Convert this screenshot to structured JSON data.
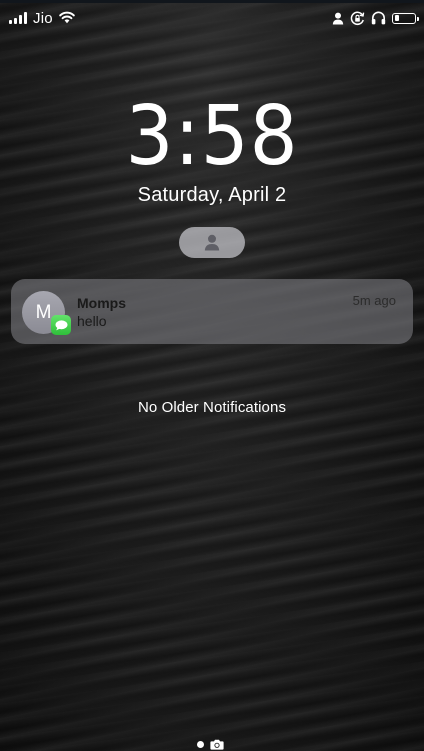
{
  "status_bar": {
    "carrier": "Jio",
    "battery_level": 0.25,
    "icons": [
      "signal-icon",
      "wifi-icon",
      "person-icon",
      "orientation-lock-icon",
      "headphones-icon",
      "battery-icon"
    ]
  },
  "lock_screen": {
    "time": "3:58",
    "date": "Saturday, April 2"
  },
  "notification": {
    "avatar_initial": "M",
    "sender": "Momps",
    "message": "hello",
    "time_ago": "5m ago",
    "app_icon": "messages-icon"
  },
  "no_older_text": "No Older Notifications",
  "bottom": {
    "icons": [
      "page-dot",
      "camera-icon"
    ]
  },
  "colors": {
    "messages_green": "#34c759",
    "notification_bg": "#78787d"
  }
}
